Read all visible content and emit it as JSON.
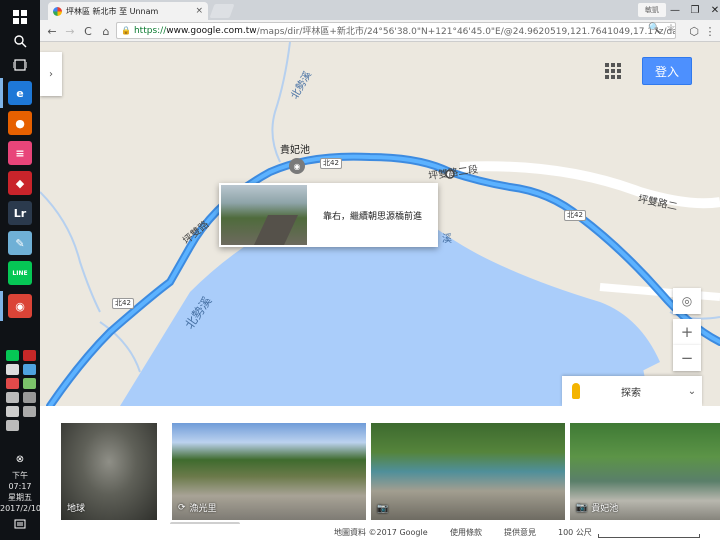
{
  "taskbar": {
    "start_icon": "windows-logo-icon",
    "search_icon": "search-icon",
    "taskview_icon": "task-view-icon",
    "apps": [
      {
        "name": "edge-icon",
        "glyph": "e",
        "color": "#1e78d7"
      },
      {
        "name": "firefox-icon",
        "glyph": "●",
        "color": "#e66000"
      },
      {
        "name": "pink-app-icon",
        "glyph": "≡",
        "color": "#e8457a"
      },
      {
        "name": "red-app-icon",
        "glyph": "◆",
        "color": "#c9242b"
      },
      {
        "name": "lightroom-icon",
        "glyph": "Lr",
        "color": "#2b3a4d"
      },
      {
        "name": "note-app-icon",
        "glyph": "✎",
        "color": "#6fb0d6"
      },
      {
        "name": "line-icon",
        "glyph": "LINE",
        "color": "#06c755"
      },
      {
        "name": "chrome-icon",
        "glyph": "◉",
        "color": "#db4437"
      }
    ],
    "clock": {
      "time": "下午 07:17",
      "weekday": "星期五",
      "date": "2017/2/10"
    }
  },
  "browser": {
    "tab_title": "坪林區 新北市 至 Unnam",
    "tab_close": "×",
    "profile": "敏凱",
    "back": "←",
    "forward": "→",
    "reload": "C",
    "home": "⌂",
    "url_scheme": "https://",
    "url_host": "www.google.com.tw",
    "url_path": "/maps/dir/坪林區+新北市/24°56'38.0\"N+121°46'45.0\"E/@24.9620519,121.7641049,17.17z/da",
    "zoom_icon": "🔍",
    "star": "☆"
  },
  "map": {
    "sidebar_toggle": "›",
    "login_label": "登入",
    "popup_text": "靠右，繼續朝思源橋前進",
    "labels": {
      "poi_name": "貴妃池",
      "river_top": "北勢溪",
      "river_mid": "北勢溪",
      "river_right": "溪",
      "road_left": "坪雙路",
      "road_top": "坪雙路二段",
      "road_right": "坪雙路二"
    },
    "shields": [
      "北42",
      "北42",
      "北42"
    ],
    "zoom_in": "+",
    "zoom_out": "−",
    "locate_icon": "◎",
    "explore_label": "探索",
    "explore_chevron": "⌄"
  },
  "photos": [
    {
      "caption": "地球",
      "icon": ""
    },
    {
      "caption": "漁光里",
      "icon": "360-icon"
    },
    {
      "caption": "",
      "icon": "camera-icon"
    },
    {
      "caption": "貴妃池",
      "icon": "camera-icon"
    }
  ],
  "footer": {
    "copyright": "地圖資料 ©2017 Google",
    "terms": "使用條款",
    "feedback": "提供意見",
    "scale": "100 公尺"
  }
}
